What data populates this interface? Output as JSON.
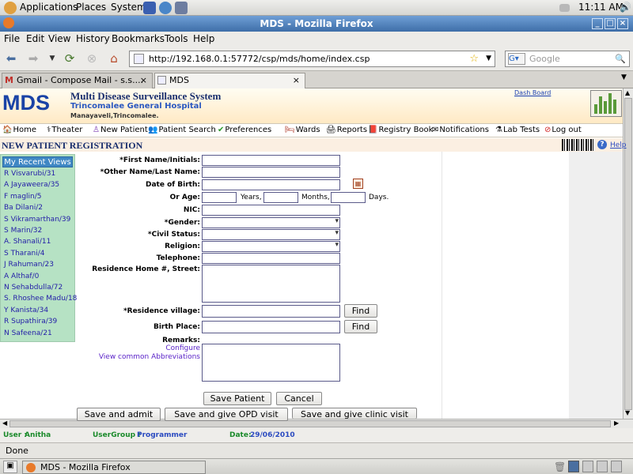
{
  "panel": {
    "applications": "Applications",
    "places": "Places",
    "system": "System",
    "clock": "11:11 AM"
  },
  "window": {
    "title": "MDS - Mozilla Firefox"
  },
  "menubar": {
    "file": "File",
    "edit": "Edit",
    "view": "View",
    "history": "History",
    "bookmarks": "Bookmarks",
    "tools": "Tools",
    "help": "Help"
  },
  "navbar": {
    "url": "http://192.168.0.1:57772/csp/mds/home/index.csp",
    "search_placeholder": "Google"
  },
  "tabs": {
    "gmail": "Gmail - Compose Mail - s.s....",
    "mds": "MDS"
  },
  "mds": {
    "logo": "MDS",
    "title": "Multi Disease Surveillance System",
    "hospital": "Trincomalee General Hospital",
    "address": "Manayaveli,Trincomalee.",
    "dashboard": "Dash Board"
  },
  "nav": {
    "home": "Home",
    "theater": "Theater",
    "new_patient": "New Patient",
    "patient_search": "Patient Search",
    "preferences": "Preferences",
    "wards": "Wards",
    "reports": "Reports",
    "registry_book": "Registry Book",
    "notifications": "Notifications",
    "lab_tests": "Lab Tests",
    "logout": "Log out"
  },
  "page": {
    "title": "NEW PATIENT REGISTRATION",
    "help": "Help"
  },
  "recent": {
    "heading": "My Recent Views",
    "items": [
      "R Visvarubi/31",
      "A Jayaweera/35",
      "F maglin/5",
      "Ba Dilani/2",
      "S Vikramarthan/39",
      "S Marin/32",
      "A. Shanali/11",
      "S Tharani/4",
      "J Rahuman/23",
      "A Althaf/0",
      "N Sehabdulla/72",
      "S. Rhoshee Madu/18",
      "Y Kanista/34",
      "R Supathira/39",
      "N Safeena/21"
    ]
  },
  "form": {
    "first_name": "*First Name/Initials:",
    "other_name": "*Other Name/Last Name:",
    "dob": "Date of Birth:",
    "or_age": "Or Age:",
    "years": "Years,",
    "months": "Months,",
    "days": "Days.",
    "nic": "NIC:",
    "gender": "*Gender:",
    "civil_status": "*Civil Status:",
    "religion": "Religion:",
    "telephone": "Telephone:",
    "residence": "Residence Home #, Street:",
    "village": "*Residence village:",
    "birth_place": "Birth Place:",
    "remarks": "Remarks:",
    "configure": "Configure",
    "abbreviations": "View common Abbreviations",
    "find": "Find",
    "save_patient": "Save  Patient",
    "cancel": "Cancel",
    "save_admit": "Save and admit",
    "save_opd": "Save and give OPD visit",
    "save_clinic": "Save and give clinic visit"
  },
  "user": {
    "user_label": "User :",
    "user": "Anitha",
    "group_label": "UserGroup :",
    "group": "Programmer",
    "date_label": "Date:",
    "date": "29/06/2010"
  },
  "status": {
    "text": "Done"
  },
  "taskbar": {
    "firefox": "MDS - Mozilla Firefox"
  }
}
